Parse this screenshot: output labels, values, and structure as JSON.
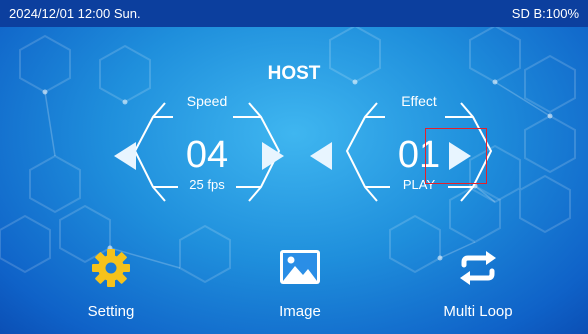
{
  "status": {
    "datetime": "2024/12/01 12:00 Sun.",
    "storage": "SD B:100%"
  },
  "title": "HOST",
  "speed": {
    "label": "Speed",
    "value": "04",
    "sub": "25 fps"
  },
  "effect": {
    "label": "Effect",
    "value": "01",
    "sub": "PLAY"
  },
  "buttons": {
    "setting": "Setting",
    "image": "Image",
    "multiloop": "Multi Loop"
  },
  "colors": {
    "status_bar": "#0c3f9e",
    "highlight": "#e3202a",
    "icon_yellow": "#f6c21a"
  },
  "icons": [
    "gear-icon",
    "image-icon",
    "loop-icon",
    "left-arrow-icon",
    "right-arrow-icon"
  ]
}
